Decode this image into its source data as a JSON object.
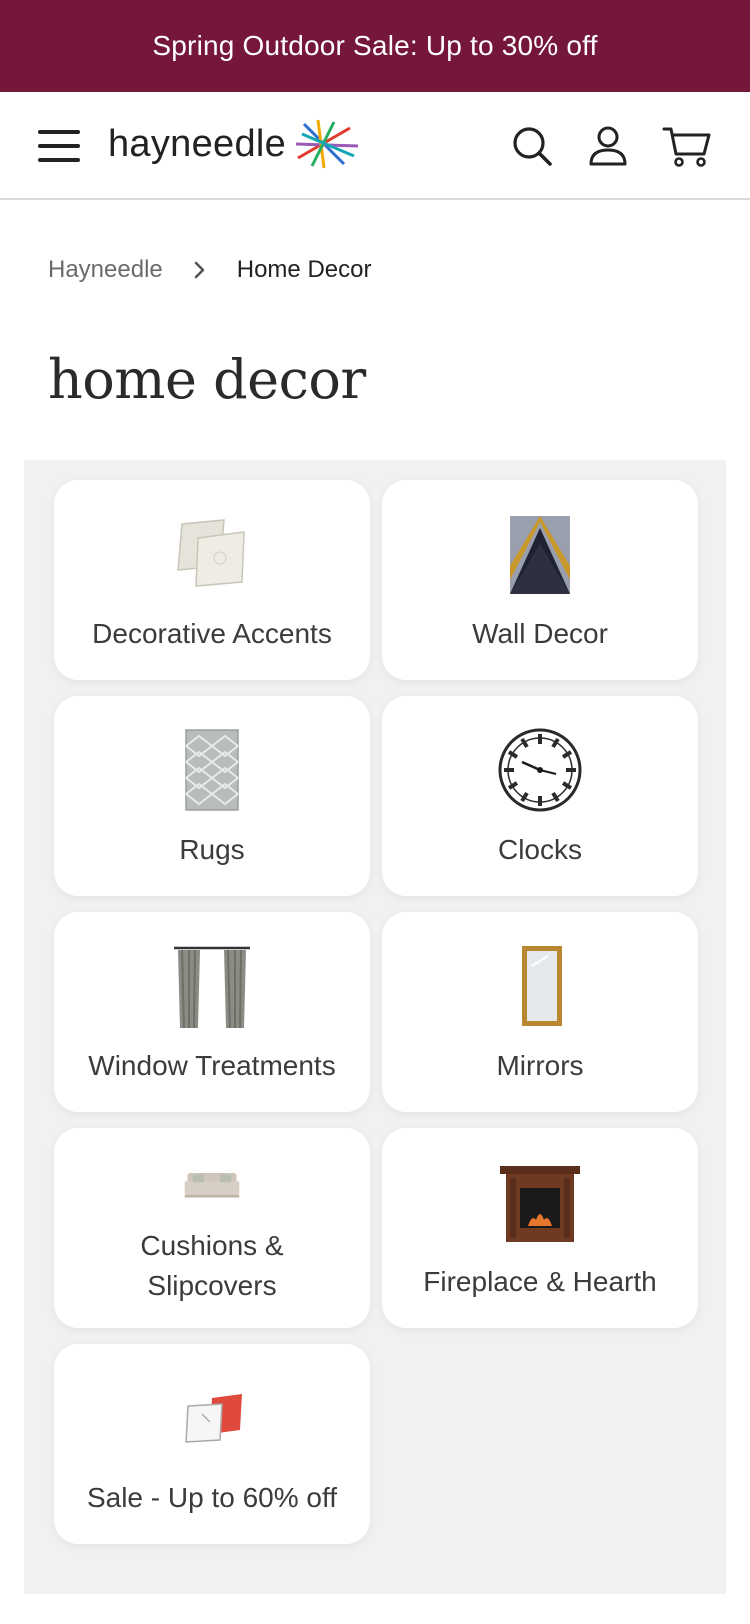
{
  "promo": {
    "text": "Spring Outdoor Sale: Up to 30% off"
  },
  "header": {
    "logo_text": "hayneedle"
  },
  "breadcrumb": {
    "items": [
      "Hayneedle",
      "Home Decor"
    ]
  },
  "page": {
    "title": "home decor"
  },
  "categories": [
    {
      "label": "Decorative Accents",
      "icon": "pillows-icon"
    },
    {
      "label": "Wall Decor",
      "icon": "wall-art-icon"
    },
    {
      "label": "Rugs",
      "icon": "rug-icon"
    },
    {
      "label": "Clocks",
      "icon": "clock-icon"
    },
    {
      "label": "Window Treatments",
      "icon": "curtains-icon"
    },
    {
      "label": "Mirrors",
      "icon": "mirror-icon"
    },
    {
      "label": "Cushions & Slipcovers",
      "icon": "sofa-icon"
    },
    {
      "label": "Fireplace & Hearth",
      "icon": "fireplace-icon"
    },
    {
      "label": "Sale - Up to 60% off",
      "icon": "sale-pillows-icon"
    }
  ],
  "colors": {
    "promo_bg": "#74173a",
    "panel_bg": "#f3f1ef",
    "tile_bg": "#ffffff"
  }
}
